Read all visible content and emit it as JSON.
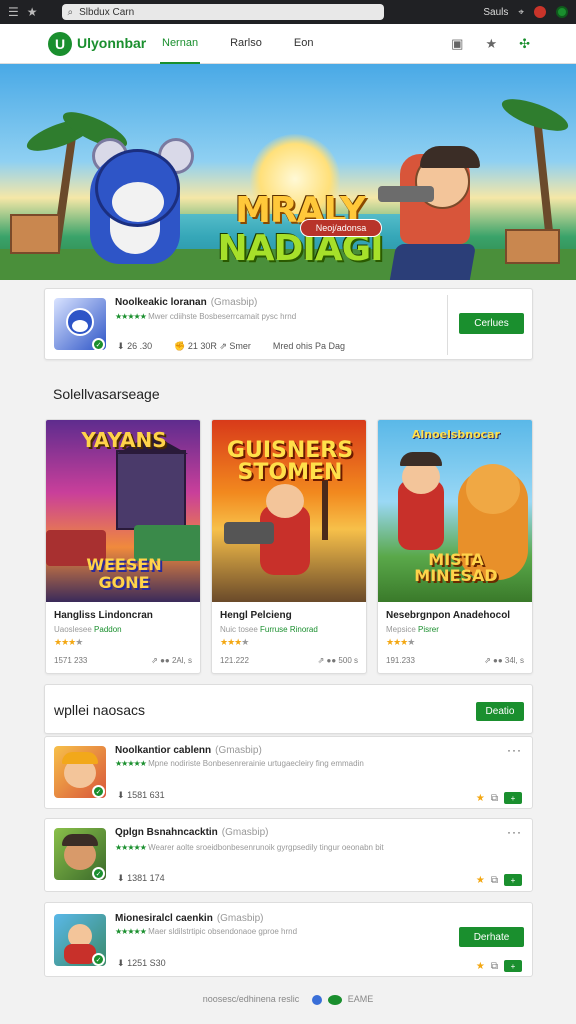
{
  "browser": {
    "url": "Slbdux Carn",
    "right_label": "Sauls"
  },
  "header": {
    "brand": "Ulyonnbar",
    "logo_letter": "U",
    "nav": [
      {
        "label": "Nernan"
      },
      {
        "label": "Rarlso"
      },
      {
        "label": "Eon"
      }
    ]
  },
  "hero": {
    "title_line1": "MRALY",
    "title_line2": "NADIAGI",
    "tag": "Neoj/adonsa"
  },
  "featured": {
    "title": "Noolkeakic loranan",
    "subtitle": "(Gmasbip)",
    "rating_text": "Mwer cdiihste Bosbeserrcamait pysc hrnd",
    "stat1": "26 .30",
    "stat2": "21 30R",
    "stat3": "Smer",
    "stat4": "Mred ohis Pa Dag",
    "button": "Cerlues"
  },
  "section1": {
    "title": "Solellvasarseage"
  },
  "tiles": [
    {
      "art_title": "YAYANS",
      "art_sub": "WEESEN GONE",
      "name": "Hangliss Lindoncran",
      "sub_a": "Uaoslesee",
      "sub_b": "Paddon",
      "foot_left": "1571 233",
      "foot_right": "2Al, s"
    },
    {
      "art_title": "GUISNERS STOMEN",
      "art_sub": "",
      "name": "Hengl Pelcieng",
      "sub_a": "Nuic tosee",
      "sub_b": "Furruse  Rinorad",
      "foot_left": "121.222",
      "foot_right": "500 s"
    },
    {
      "art_title": "Alnoelsbnocar",
      "art_sub": "MISTA MINESAD",
      "name": "Nesebrgnpon Anadehocol",
      "sub_a": "Mepsice",
      "sub_b": "Pisrer",
      "foot_left": "191.233",
      "foot_right": "34l, s"
    }
  ],
  "section2": {
    "title": "wpllei naosacs",
    "button": "Deatio"
  },
  "list": [
    {
      "title": "Noolkantior cablenn",
      "subtitle": "(Gmasbip)",
      "rating_text": "Mpne nodiriste Bonbesenrerainie urtugaecleiry fing emmadin",
      "stat": "1581 631"
    },
    {
      "title": "Qplgn Bsnahncacktin",
      "subtitle": "(Gmasbip)",
      "rating_text": "Wearer aolte sroeidbonbesenrunoik gyrgpsedily tingur oeonabn bit",
      "stat": "1381 174"
    },
    {
      "title": "Mionesiralcl caenkin",
      "subtitle": "(Gmasbip)",
      "rating_text": "Maer sldilstrtipic obsendonaoe gproe hrnd",
      "stat": "1251 S30",
      "button": "Derhate"
    }
  ],
  "footer": {
    "text": "noosesc/edhinena reslic",
    "badge": "EAME"
  },
  "colors": {
    "accent": "#1a8f2e",
    "star": "#f3a712"
  }
}
